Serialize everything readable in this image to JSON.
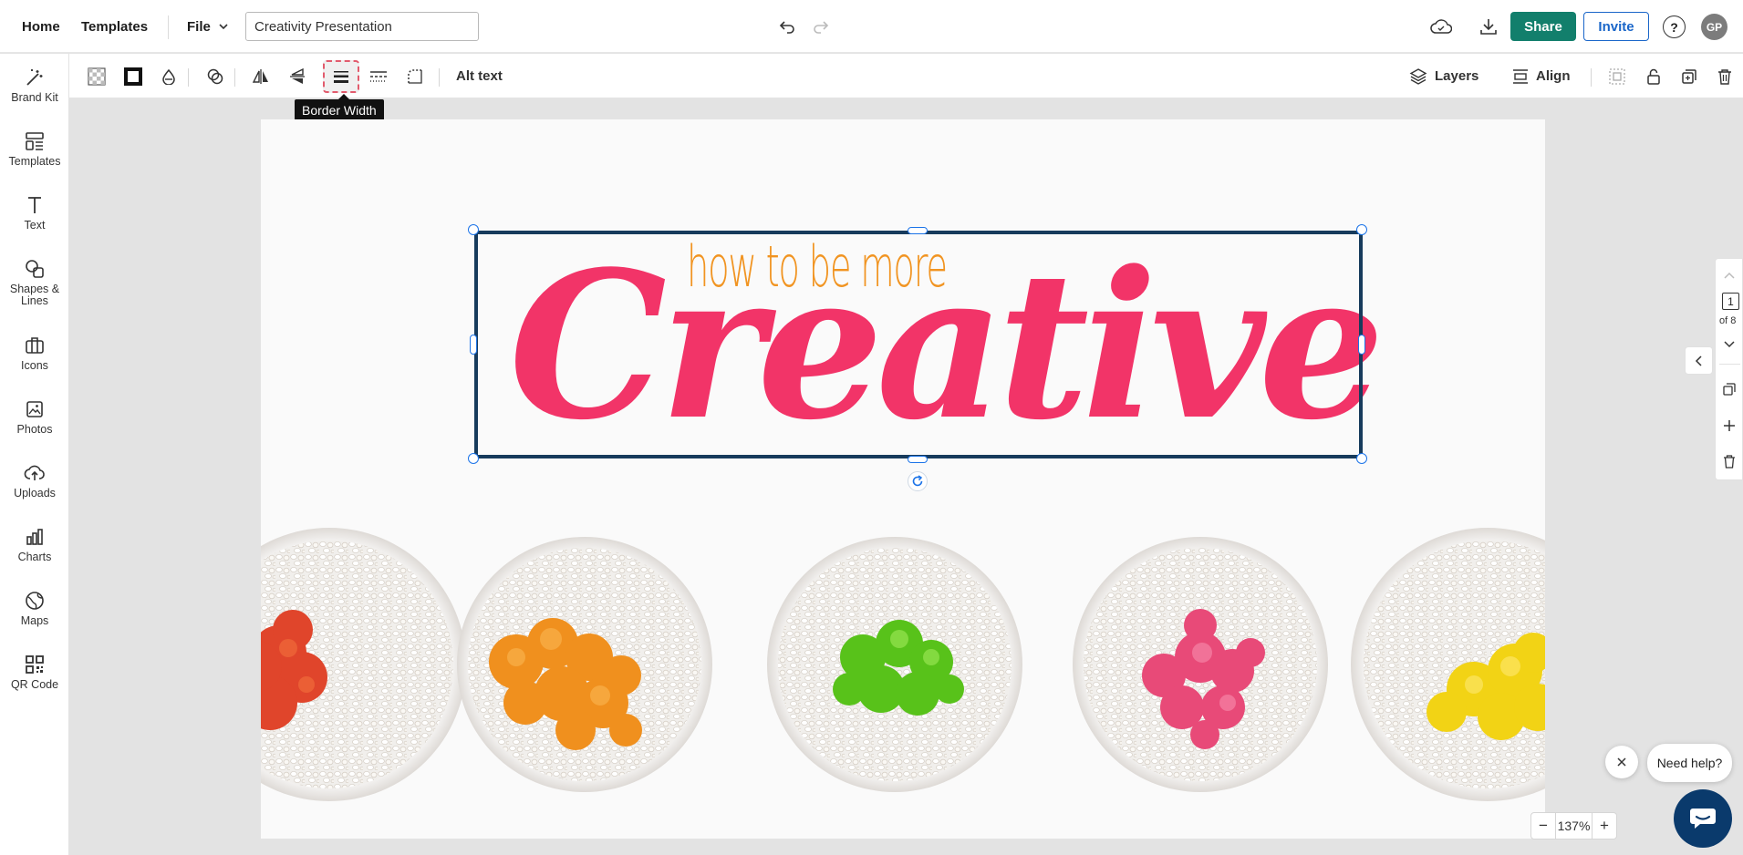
{
  "header": {
    "home": "Home",
    "templates": "Templates",
    "file": "File",
    "doc_title": "Creativity Presentation",
    "share": "Share",
    "invite": "Invite",
    "help": "?",
    "avatar": "GP"
  },
  "sidebar": {
    "items": [
      {
        "label": "Brand Kit",
        "icon": "magic-wand-icon"
      },
      {
        "label": "Templates",
        "icon": "templates-icon"
      },
      {
        "label": "Text",
        "icon": "text-icon"
      },
      {
        "label": "Shapes & Lines",
        "icon": "shapes-icon"
      },
      {
        "label": "Icons",
        "icon": "briefcase-icon"
      },
      {
        "label": "Photos",
        "icon": "photo-icon"
      },
      {
        "label": "Uploads",
        "icon": "upload-icon"
      },
      {
        "label": "Charts",
        "icon": "chart-icon"
      },
      {
        "label": "Maps",
        "icon": "globe-icon"
      },
      {
        "label": "QR Code",
        "icon": "qr-icon"
      }
    ]
  },
  "toolbar": {
    "alt_text": "Alt text",
    "layers": "Layers",
    "align": "Align",
    "tooltip": "Border Width"
  },
  "canvas": {
    "subtitle": "how to be more",
    "title": "Creative"
  },
  "pager": {
    "current": "1",
    "total": "of 8"
  },
  "zoom": {
    "minus": "−",
    "value": "137%",
    "plus": "+"
  },
  "support": {
    "need_help": "Need help?"
  },
  "colors": {
    "accent_share": "#127f6c",
    "accent_invite": "#1a66c9",
    "title_pink": "#f23468",
    "subtitle_orange": "#f19421",
    "selection_border": "#173b5c"
  }
}
